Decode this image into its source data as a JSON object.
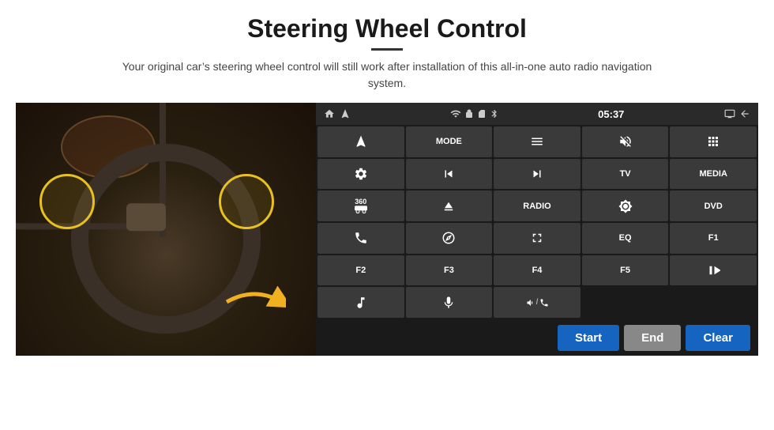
{
  "header": {
    "title": "Steering Wheel Control",
    "subtitle": "Your original car’s steering wheel control will still work after installation of this all-in-one auto radio navigation system."
  },
  "status_bar": {
    "time": "05:37",
    "icons": [
      "home",
      "wifi",
      "lock",
      "sd",
      "bluetooth",
      "screen",
      "back"
    ]
  },
  "control_buttons": [
    {
      "id": "nav",
      "label": "",
      "icon": "navigate",
      "row": 1,
      "col": 1
    },
    {
      "id": "mode",
      "label": "MODE",
      "icon": "",
      "row": 1,
      "col": 2
    },
    {
      "id": "list",
      "label": "",
      "icon": "list",
      "row": 1,
      "col": 3
    },
    {
      "id": "mute",
      "label": "",
      "icon": "mute",
      "row": 1,
      "col": 4
    },
    {
      "id": "apps",
      "label": "",
      "icon": "apps",
      "row": 1,
      "col": 5
    },
    {
      "id": "settings",
      "label": "",
      "icon": "settings",
      "row": 2,
      "col": 1
    },
    {
      "id": "prev",
      "label": "",
      "icon": "prev",
      "row": 2,
      "col": 2
    },
    {
      "id": "next",
      "label": "",
      "icon": "next",
      "row": 2,
      "col": 3
    },
    {
      "id": "tv",
      "label": "TV",
      "icon": "",
      "row": 2,
      "col": 4
    },
    {
      "id": "media",
      "label": "MEDIA",
      "icon": "",
      "row": 2,
      "col": 5
    },
    {
      "id": "cam360",
      "label": "360",
      "icon": "car",
      "row": 3,
      "col": 1
    },
    {
      "id": "eject",
      "label": "",
      "icon": "eject",
      "row": 3,
      "col": 2
    },
    {
      "id": "radio",
      "label": "RADIO",
      "icon": "",
      "row": 3,
      "col": 3
    },
    {
      "id": "brightness",
      "label": "",
      "icon": "brightness",
      "row": 3,
      "col": 4
    },
    {
      "id": "dvd",
      "label": "DVD",
      "icon": "",
      "row": 3,
      "col": 5
    },
    {
      "id": "phone",
      "label": "",
      "icon": "phone",
      "row": 4,
      "col": 1
    },
    {
      "id": "navi",
      "label": "",
      "icon": "navi",
      "row": 4,
      "col": 2
    },
    {
      "id": "screen",
      "label": "",
      "icon": "screen",
      "row": 4,
      "col": 3
    },
    {
      "id": "eq",
      "label": "EQ",
      "icon": "",
      "row": 4,
      "col": 4
    },
    {
      "id": "f1",
      "label": "F1",
      "icon": "",
      "row": 4,
      "col": 5
    },
    {
      "id": "f2",
      "label": "F2",
      "icon": "",
      "row": 5,
      "col": 1
    },
    {
      "id": "f3",
      "label": "F3",
      "icon": "",
      "row": 5,
      "col": 2
    },
    {
      "id": "f4",
      "label": "F4",
      "icon": "",
      "row": 5,
      "col": 3
    },
    {
      "id": "f5",
      "label": "F5",
      "icon": "",
      "row": 5,
      "col": 4
    },
    {
      "id": "playpause",
      "label": "",
      "icon": "playpause",
      "row": 5,
      "col": 5
    },
    {
      "id": "music",
      "label": "",
      "icon": "music",
      "row": 6,
      "col": 1
    },
    {
      "id": "mic",
      "label": "",
      "icon": "mic",
      "row": 6,
      "col": 2
    },
    {
      "id": "volphone",
      "label": "",
      "icon": "volphone",
      "row": 6,
      "col": 3
    }
  ],
  "action_bar": {
    "start_label": "Start",
    "end_label": "End",
    "clear_label": "Clear"
  }
}
